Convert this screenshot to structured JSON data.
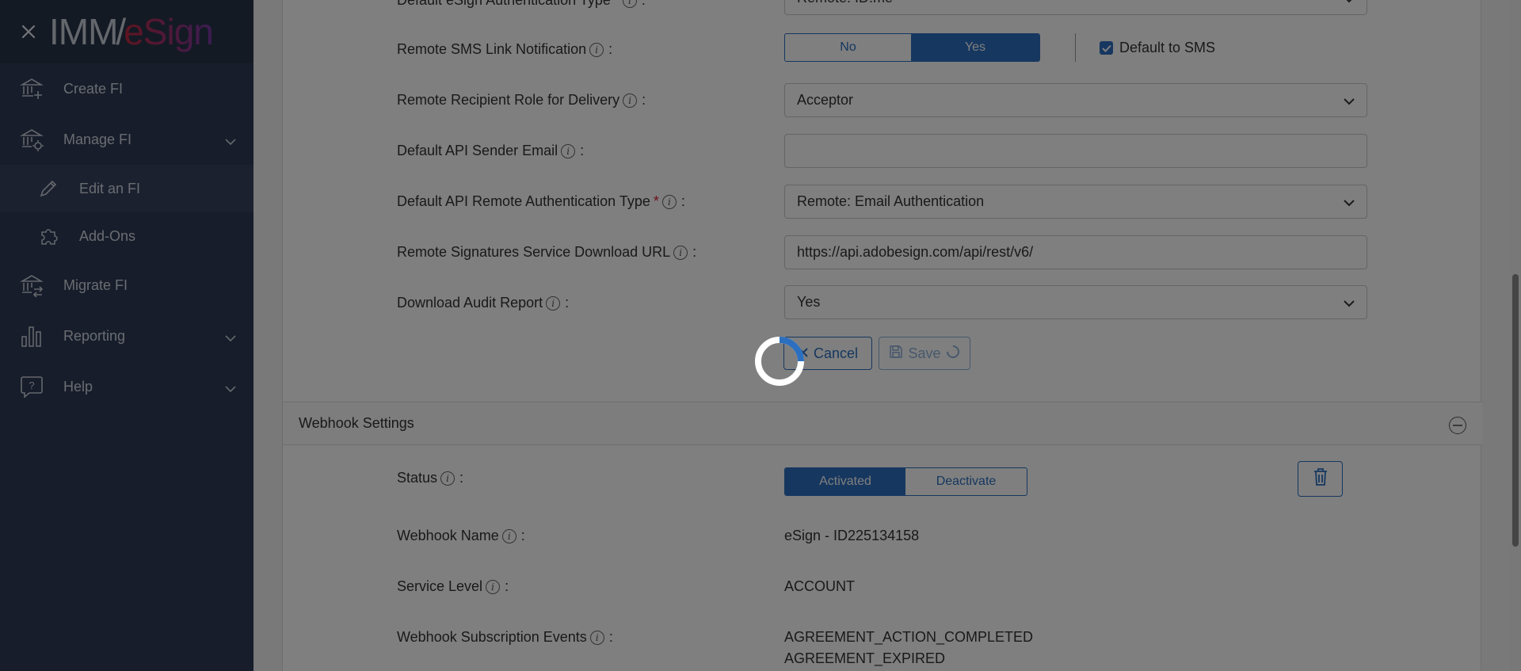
{
  "sidebar": {
    "logo": {
      "part1": "IMM",
      "part2": "eSign"
    },
    "items": [
      {
        "label": "Create FI",
        "icon": "bank-plus-icon"
      },
      {
        "label": "Manage FI",
        "icon": "bank-gear-icon"
      },
      {
        "label": "Edit an FI",
        "icon": "pencil-icon"
      },
      {
        "label": "Add-Ons",
        "icon": "puzzle-icon"
      },
      {
        "label": "Migrate FI",
        "icon": "bank-arrows-icon"
      },
      {
        "label": "Reporting",
        "icon": "bar-chart-icon"
      },
      {
        "label": "Help",
        "icon": "help-bubble-icon"
      }
    ]
  },
  "form": {
    "top_label": "Default eSign Authentication Type",
    "top_value": "Remote: ID.me",
    "sms_label": "Remote SMS Link Notification",
    "sms_no": "No",
    "sms_yes": "Yes",
    "sms_default": "Default to SMS",
    "role_label": "Remote Recipient Role for Delivery",
    "role_value": "Acceptor",
    "api_email_label": "Default API Sender Email",
    "api_email_value": "",
    "api_auth_label": "Default API Remote Authentication Type",
    "api_auth_value": "Remote: Email Authentication",
    "url_label": "Remote Signatures Service Download URL",
    "url_value": "https://api.adobesign.com/api/rest/v6/",
    "audit_label": "Download Audit Report",
    "audit_value": "Yes",
    "cancel": "Cancel",
    "save": "Save"
  },
  "webhook": {
    "title": "Webhook Settings",
    "status_label": "Status",
    "activated": "Activated",
    "deactivate": "Deactivate",
    "name_label": "Webhook Name",
    "name_value": "eSign - ID225134158",
    "level_label": "Service Level",
    "level_value": "ACCOUNT",
    "events_label": "Webhook Subscription Events",
    "events": [
      "AGREEMENT_ACTION_COMPLETED",
      "AGREEMENT_EXPIRED"
    ]
  },
  "colors": {
    "sidebar": "#2f3b55",
    "accent": "#2c6fbf",
    "required": "#d9233b"
  }
}
